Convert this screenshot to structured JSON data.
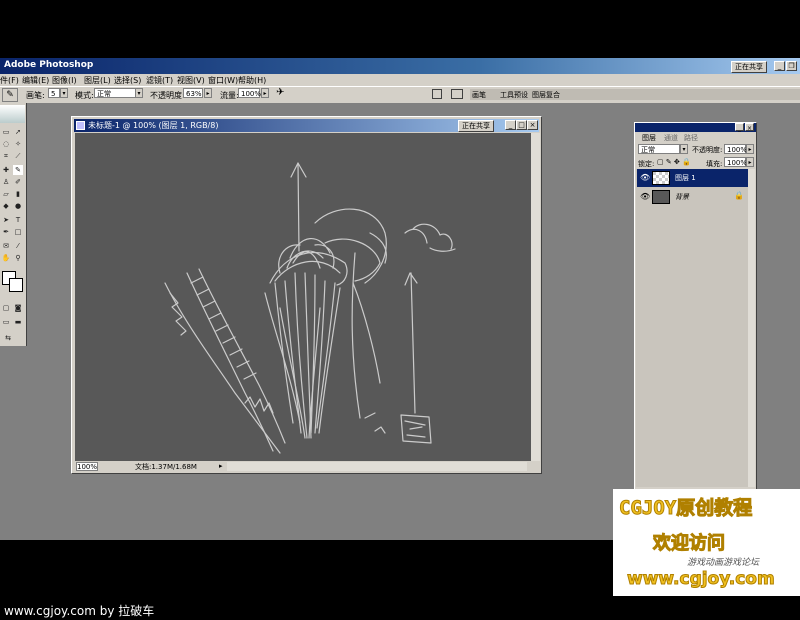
{
  "titlebar": {
    "title": "Adobe Photoshop",
    "share_label": "正在共享",
    "min": "_",
    "restore": "❐"
  },
  "menu": [
    "件(F)",
    "编辑(E)",
    "图像(I)",
    "图层(L)",
    "选择(S)",
    "滤镜(T)",
    "视图(V)",
    "窗口(W)",
    "帮助(H)"
  ],
  "options": {
    "brush_label": "画笔:",
    "brush_size": "5",
    "mode_label": "模式:",
    "mode_value": "正常",
    "opacity_label": "不透明度:",
    "opacity_value": "63%",
    "flow_label": "流量:",
    "flow_value": "100%",
    "palette_tabs": [
      "画笔",
      "工具预设",
      "图层复合"
    ]
  },
  "document": {
    "title": "未标题-1 @ 100% (图层 1, RGB/8)",
    "share_label": "正在共享",
    "zoom": "100%",
    "doc_info": "文档:1.37M/1.68M"
  },
  "layers_panel": {
    "tabs": [
      "图层",
      "通道",
      "路径"
    ],
    "blend_mode": "正常",
    "opacity_label": "不透明度:",
    "opacity_value": "100%",
    "lock_label": "锁定:",
    "fill_label": "填充:",
    "fill_value": "100%",
    "layers": [
      {
        "name": "图层 1",
        "selected": true
      },
      {
        "name": "背景",
        "selected": false
      }
    ]
  },
  "watermark": {
    "line1": "CGJOY原创教程",
    "line2": "欢迎访问",
    "line3": "游戏动画游戏论坛",
    "line4": "www.cgjoy.com"
  },
  "footer": {
    "credit": "www.cgjoy.com by 拉破车"
  },
  "colors": {
    "accent": "#0a246a",
    "chrome": "#d4d0c8",
    "workspace": "#808080",
    "canvas": "#585858",
    "watermark_yellow": "#f0c020"
  }
}
